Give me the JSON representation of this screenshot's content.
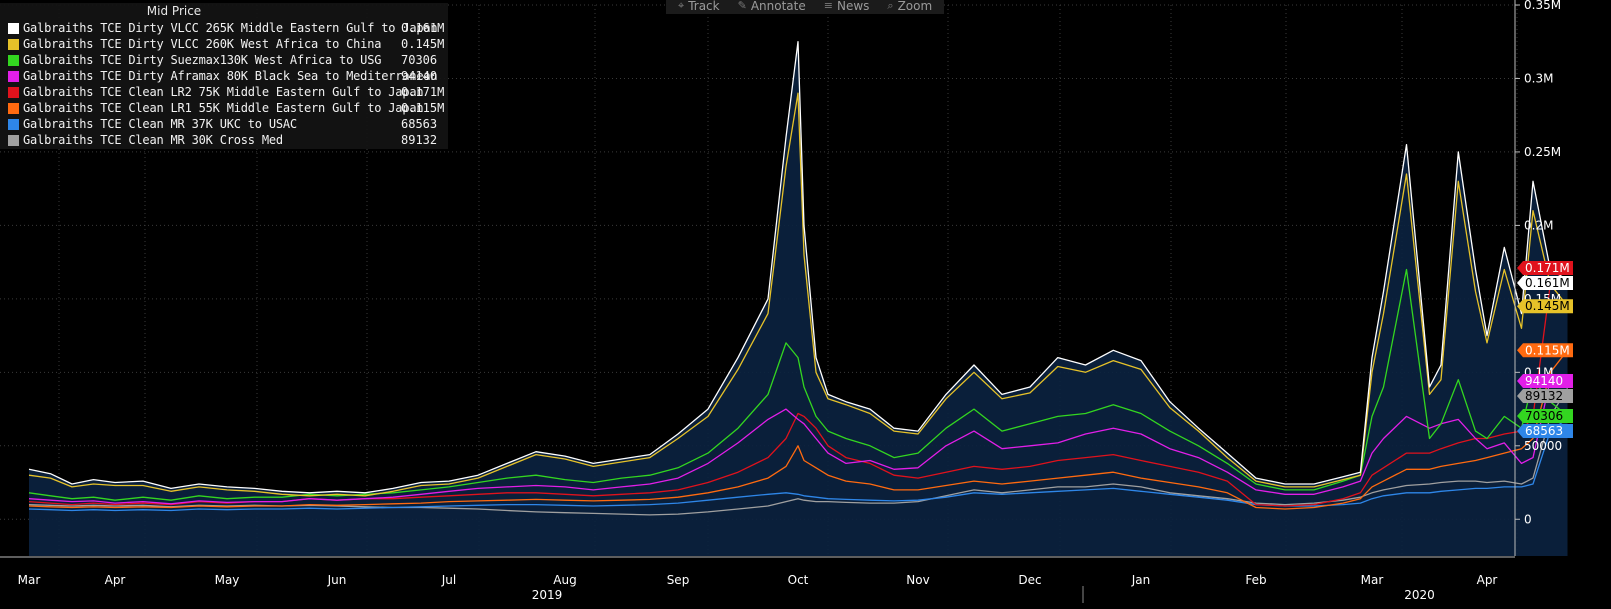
{
  "toolbar": {
    "items": [
      {
        "label": "Track",
        "icon": "crosshair-icon",
        "glyph": "⌖"
      },
      {
        "label": "Annotate",
        "icon": "pencil-icon",
        "glyph": "✎"
      },
      {
        "label": "News",
        "icon": "news-icon",
        "glyph": "≡"
      },
      {
        "label": "Zoom",
        "icon": "magnifier-icon",
        "glyph": "⌕"
      }
    ]
  },
  "legend": {
    "title": "Mid Price"
  },
  "chart_data": {
    "type": "line",
    "title": "",
    "xlabel": "",
    "ylabel": "",
    "ylim": [
      -25000,
      350000
    ],
    "grid": true,
    "legend_placement": "top-left",
    "y_ticks": [
      {
        "value": 0,
        "label": "0"
      },
      {
        "value": 50000,
        "label": "50000"
      },
      {
        "value": 100000,
        "label": "0.1M"
      },
      {
        "value": 150000,
        "label": "0.15M"
      },
      {
        "value": 200000,
        "label": "0.2M"
      },
      {
        "value": 250000,
        "label": "0.25M"
      },
      {
        "value": 300000,
        "label": "0.3M"
      },
      {
        "value": 350000,
        "label": "0.35M"
      }
    ],
    "x_labels": [
      "Mar",
      "Apr",
      "May",
      "Jun",
      "Jul",
      "Aug",
      "Sep",
      "Oct",
      "Nov",
      "Dec",
      "Jan",
      "Feb",
      "Mar",
      "Apr"
    ],
    "x_labels_month_index": [
      0,
      1,
      2,
      3,
      4,
      5,
      6,
      7,
      8,
      9,
      10,
      11,
      12,
      13
    ],
    "year_labels": [
      {
        "label": "2019",
        "month_center": 4.5
      },
      {
        "label": "2020",
        "month_center": 12.5
      }
    ],
    "x": [
      0,
      0.25,
      0.5,
      0.75,
      1,
      1.25,
      1.5,
      1.75,
      2,
      2.25,
      2.5,
      2.75,
      3,
      3.25,
      3.5,
      3.75,
      4,
      4.25,
      4.5,
      4.75,
      5,
      5.25,
      5.5,
      5.75,
      6,
      6.25,
      6.5,
      6.75,
      6.9,
      7,
      7.05,
      7.15,
      7.25,
      7.4,
      7.6,
      7.8,
      8,
      8.25,
      8.5,
      8.75,
      9,
      9.25,
      9.5,
      9.75,
      10,
      10.25,
      10.5,
      10.75,
      11,
      11.25,
      11.5,
      11.75,
      11.9,
      12,
      12.1,
      12.3,
      12.5,
      12.6,
      12.75,
      12.9,
      13,
      13.15,
      13.3,
      13.4,
      13.55,
      13.7
    ],
    "series": [
      {
        "name": "Galbraiths TCE Dirty VLCC 265K Middle Eastern Gulf to Japan",
        "color": "#ffffff",
        "last_label": "0.161M",
        "values": [
          34000,
          31000,
          24000,
          27000,
          25000,
          26000,
          21000,
          24000,
          22000,
          21000,
          19000,
          18000,
          19000,
          18000,
          21000,
          25000,
          26000,
          30000,
          38000,
          46000,
          43000,
          38000,
          41000,
          44000,
          58000,
          75000,
          110000,
          150000,
          260000,
          325000,
          200000,
          110000,
          85000,
          80000,
          75000,
          62000,
          60000,
          85000,
          105000,
          85000,
          90000,
          110000,
          105000,
          115000,
          108000,
          80000,
          62000,
          45000,
          28000,
          24000,
          24000,
          29000,
          32000,
          110000,
          155000,
          255000,
          90000,
          105000,
          250000,
          170000,
          125000,
          185000,
          140000,
          230000,
          170000,
          163000
        ]
      },
      {
        "name": "Galbraiths TCE Dirty VLCC 260K West Africa to China",
        "color": "#e6c229",
        "last_label": "0.145M",
        "values": [
          30000,
          28000,
          22000,
          24000,
          23000,
          23000,
          19000,
          22000,
          20000,
          19000,
          17000,
          16000,
          17000,
          16000,
          19000,
          23000,
          24000,
          28000,
          36000,
          44000,
          41000,
          36000,
          39000,
          42000,
          55000,
          70000,
          102000,
          140000,
          240000,
          290000,
          180000,
          100000,
          82000,
          78000,
          72000,
          60000,
          58000,
          82000,
          100000,
          82000,
          86000,
          104000,
          100000,
          108000,
          102000,
          76000,
          60000,
          42000,
          26000,
          22000,
          22000,
          27000,
          30000,
          100000,
          140000,
          235000,
          85000,
          95000,
          230000,
          155000,
          120000,
          170000,
          130000,
          210000,
          160000,
          145000
        ]
      },
      {
        "name": "Galbraiths TCE Dirty Suezmax130K West Africa to USG",
        "color": "#33d620",
        "last_label": "70306",
        "values": [
          18000,
          16000,
          14000,
          15000,
          13000,
          15000,
          13000,
          16000,
          14000,
          15000,
          15000,
          17000,
          16000,
          17000,
          18000,
          20000,
          22000,
          25000,
          28000,
          30000,
          27000,
          25000,
          28000,
          30000,
          35000,
          45000,
          62000,
          85000,
          120000,
          110000,
          90000,
          70000,
          60000,
          55000,
          50000,
          42000,
          45000,
          62000,
          75000,
          60000,
          65000,
          70000,
          72000,
          78000,
          72000,
          60000,
          50000,
          38000,
          24000,
          20000,
          20000,
          26000,
          30000,
          70000,
          90000,
          170000,
          55000,
          65000,
          95000,
          60000,
          55000,
          70000,
          62000,
          95000,
          80000,
          70306
        ]
      },
      {
        "name": "Galbraiths TCE Dirty Aframax 80K Black Sea to Mediterranean",
        "color": "#e21fe8",
        "last_label": "94140",
        "values": [
          14000,
          13000,
          12000,
          12500,
          11000,
          12000,
          10500,
          12500,
          11500,
          12000,
          12000,
          14000,
          13000,
          14000,
          15000,
          17000,
          19000,
          21000,
          22000,
          23000,
          22000,
          20000,
          22000,
          24000,
          28000,
          38000,
          52000,
          68000,
          75000,
          68000,
          65000,
          55000,
          45000,
          38000,
          40000,
          34000,
          35000,
          50000,
          60000,
          48000,
          50000,
          52000,
          58000,
          62000,
          58000,
          48000,
          42000,
          32000,
          20000,
          17000,
          17000,
          22000,
          26000,
          45000,
          55000,
          70000,
          62000,
          65000,
          68000,
          55000,
          48000,
          52000,
          38000,
          42000,
          95000,
          94140
        ]
      },
      {
        "name": "Galbraiths TCE Clean LR2 75K Middle Eastern Gulf to Japan",
        "color": "#e0121c",
        "last_label": "0.171M",
        "values": [
          12000,
          11000,
          10000,
          11000,
          10000,
          11000,
          10000,
          12000,
          11000,
          12000,
          12000,
          14000,
          13000,
          14000,
          14000,
          15000,
          16000,
          17000,
          18000,
          18000,
          17000,
          16000,
          17000,
          18000,
          20000,
          25000,
          32000,
          42000,
          55000,
          72000,
          70000,
          62000,
          50000,
          42000,
          38000,
          30000,
          28000,
          32000,
          36000,
          34000,
          36000,
          40000,
          42000,
          44000,
          40000,
          36000,
          32000,
          26000,
          10000,
          9000,
          10000,
          14000,
          18000,
          30000,
          35000,
          45000,
          45000,
          48000,
          52000,
          55000,
          55000,
          58000,
          60000,
          70000,
          160000,
          171000
        ]
      },
      {
        "name": "Galbraiths TCE Clean LR1 55K Middle Eastern Gulf to Japan",
        "color": "#ff6a10",
        "last_label": "0.115M",
        "values": [
          9000,
          8500,
          8000,
          8500,
          8000,
          8500,
          8000,
          9000,
          8500,
          9000,
          9000,
          10000,
          9500,
          10000,
          10500,
          11000,
          12000,
          12500,
          13000,
          13500,
          13000,
          12500,
          13000,
          13500,
          15000,
          18000,
          22000,
          28000,
          36000,
          50000,
          40000,
          35000,
          30000,
          26000,
          24000,
          20000,
          20000,
          23000,
          26000,
          24000,
          26000,
          28000,
          30000,
          32000,
          28000,
          25000,
          22000,
          18000,
          8000,
          7000,
          8000,
          11000,
          14000,
          22000,
          26000,
          34000,
          34000,
          36000,
          38000,
          40000,
          42000,
          45000,
          48000,
          55000,
          100000,
          115000
        ]
      },
      {
        "name": "Galbraiths TCE Clean MR 37K UKC to USAC",
        "color": "#2e86e8",
        "last_label": "68563",
        "values": [
          7000,
          6500,
          6000,
          6500,
          6000,
          6500,
          6000,
          7000,
          6500,
          7000,
          7000,
          7500,
          7000,
          7500,
          8000,
          8500,
          9000,
          9500,
          10000,
          10000,
          9500,
          9000,
          9500,
          10000,
          11000,
          13000,
          15000,
          17000,
          18000,
          17000,
          16000,
          15000,
          14000,
          13500,
          13000,
          12500,
          13000,
          15000,
          18000,
          17000,
          18000,
          19000,
          20000,
          21000,
          19000,
          17000,
          15000,
          13000,
          10000,
          9000,
          9000,
          10000,
          11000,
          14000,
          16000,
          18000,
          18000,
          19000,
          20000,
          21000,
          21000,
          22000,
          22000,
          24000,
          60000,
          68563
        ]
      },
      {
        "name": "Galbraiths TCE Clean MR 30K Cross Med",
        "color": "#a0a0a0",
        "last_label": "89132",
        "values": [
          10000,
          9500,
          9000,
          9500,
          9000,
          9500,
          8500,
          9500,
          9000,
          9500,
          9000,
          9500,
          9000,
          8500,
          8000,
          8000,
          7500,
          7000,
          6000,
          5000,
          4500,
          4000,
          3500,
          3000,
          3500,
          5000,
          7000,
          9000,
          12000,
          14000,
          13000,
          12000,
          12000,
          11500,
          11000,
          11000,
          12000,
          16000,
          20000,
          18000,
          20000,
          22000,
          22000,
          24000,
          22000,
          18000,
          16000,
          14000,
          11000,
          10000,
          11000,
          13000,
          15000,
          18000,
          20000,
          23000,
          24000,
          25000,
          26000,
          26000,
          25000,
          26000,
          24000,
          28000,
          70000,
          89132
        ]
      }
    ]
  }
}
